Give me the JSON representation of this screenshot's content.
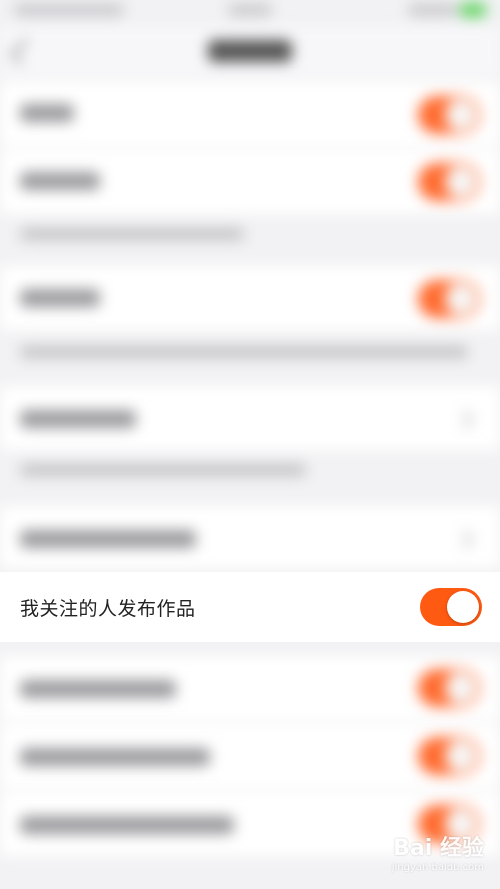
{
  "setting": {
    "label": "我关注的人发布作品",
    "enabled": true,
    "accent_color": "#ff5a12"
  },
  "watermark": {
    "brand": "Bai 经验",
    "url": "jingyan.baidu.com"
  }
}
